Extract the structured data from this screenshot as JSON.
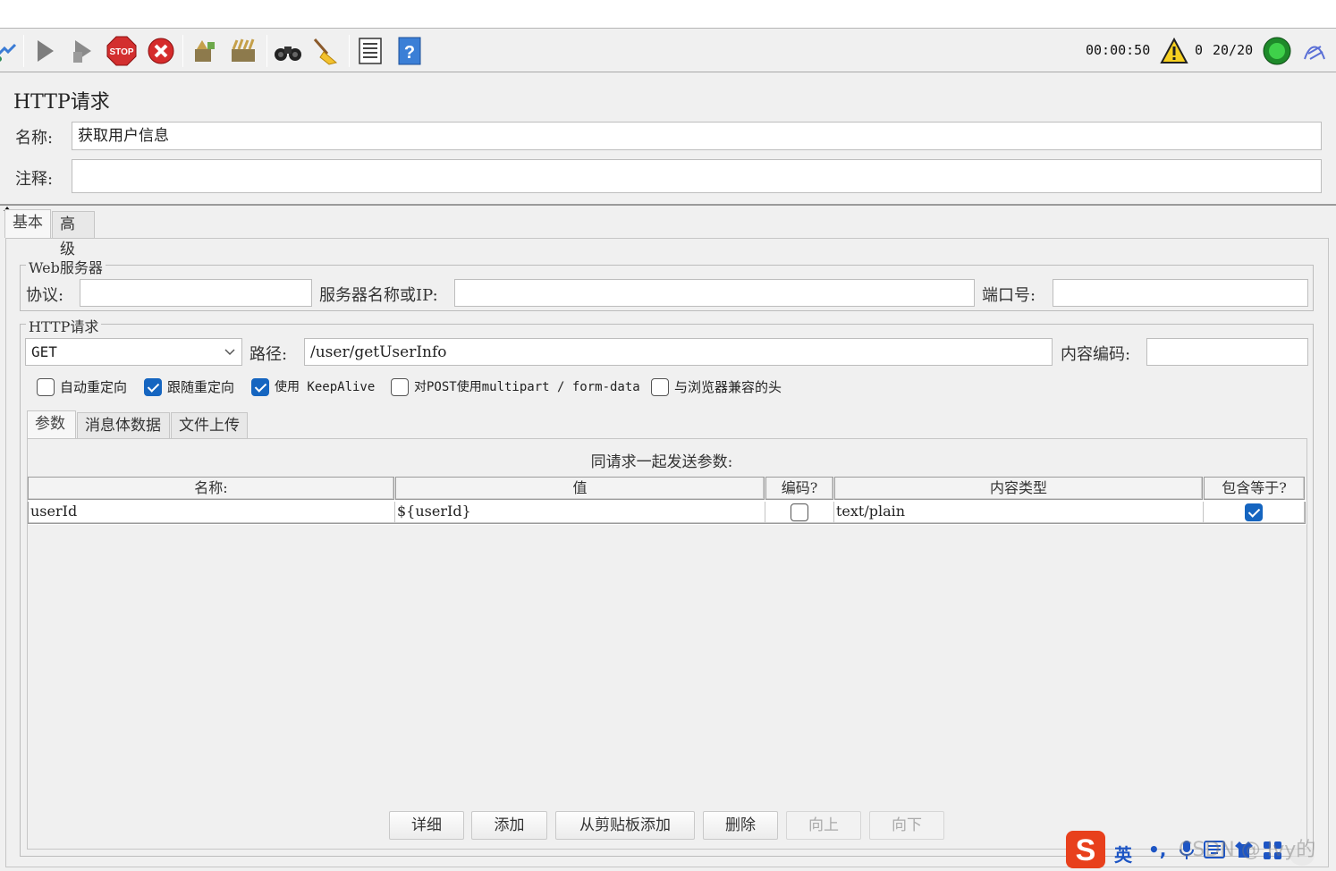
{
  "toolbar": {
    "timer": "00:00:50",
    "warning_count": "0",
    "threads": "20/20"
  },
  "element": {
    "title": "HTTP请求",
    "name_label": "名称:",
    "name_value": "获取用户信息",
    "comment_label": "注释:",
    "comment_value": ""
  },
  "tabs": [
    {
      "label": "基本",
      "active": true
    },
    {
      "label": "高级",
      "active": false
    }
  ],
  "web_server": {
    "title": "Web服务器",
    "protocol_label": "协议:",
    "protocol_value": "",
    "server_label": "服务器名称或IP:",
    "server_value": "",
    "port_label": "端口号:",
    "port_value": ""
  },
  "http_request": {
    "title": "HTTP请求",
    "method": "GET",
    "path_label": "路径:",
    "path_value": "/user/getUserInfo",
    "encoding_label": "内容编码:",
    "encoding_value": "",
    "options": [
      {
        "label": "自动重定向",
        "checked": false
      },
      {
        "label": "跟随重定向",
        "checked": true
      },
      {
        "label": "使用 KeepAlive",
        "checked": true
      },
      {
        "label": "对POST使用multipart / form-data",
        "checked": false
      },
      {
        "label": "与浏览器兼容的头",
        "checked": false
      }
    ]
  },
  "sub_tabs": [
    {
      "label": "参数",
      "active": true
    },
    {
      "label": "消息体数据",
      "active": false
    },
    {
      "label": "文件上传",
      "active": false
    }
  ],
  "params": {
    "caption": "同请求一起发送参数:",
    "columns": [
      "名称:",
      "值",
      "编码?",
      "内容类型",
      "包含等于?"
    ],
    "rows": [
      {
        "name": "userId",
        "value": "${userId}",
        "encode": false,
        "content_type": "text/plain",
        "include_equals": true
      }
    ]
  },
  "buttons": [
    {
      "label": "详细",
      "enabled": true
    },
    {
      "label": "添加",
      "enabled": true
    },
    {
      "label": "从剪贴板添加",
      "enabled": true
    },
    {
      "label": "删除",
      "enabled": true
    },
    {
      "label": "向上",
      "enabled": false
    },
    {
      "label": "向下",
      "enabled": false
    }
  ],
  "ime": {
    "mode": "英",
    "punct": "•,",
    "watermark": "CSDN @ Ivy的"
  }
}
